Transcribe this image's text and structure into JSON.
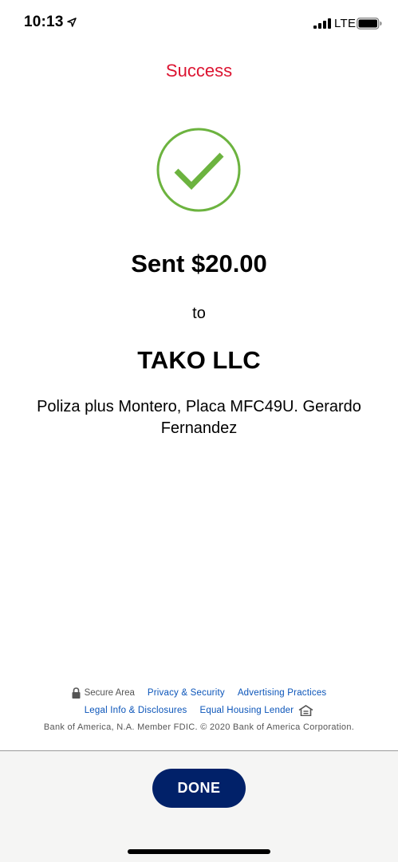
{
  "status_bar": {
    "time": "10:13",
    "network": "LTE",
    "icons": [
      "location-arrow-icon",
      "signal-bars-icon",
      "battery-icon"
    ]
  },
  "header": {
    "title": "Success",
    "title_color": "#dc1431"
  },
  "confirmation": {
    "icon": "checkmark-circle-icon",
    "icon_color": "#6cb33f",
    "amount_text": "Sent $20.00",
    "to_label": "to",
    "recipient": "TAKO LLC",
    "memo": "Poliza plus Montero, Placa MFC49U. Gerardo Fernandez"
  },
  "footer": {
    "secure_area": "Secure Area",
    "links": {
      "privacy": "Privacy & Security",
      "advertising": "Advertising Practices",
      "legal": "Legal Info & Disclosures",
      "housing": "Equal Housing Lender"
    },
    "copyright": "Bank of America, N.A. Member FDIC. © 2020 Bank of America Corporation.",
    "link_color": "#0a54b9"
  },
  "actions": {
    "done_label": "DONE",
    "done_color": "#012169"
  }
}
